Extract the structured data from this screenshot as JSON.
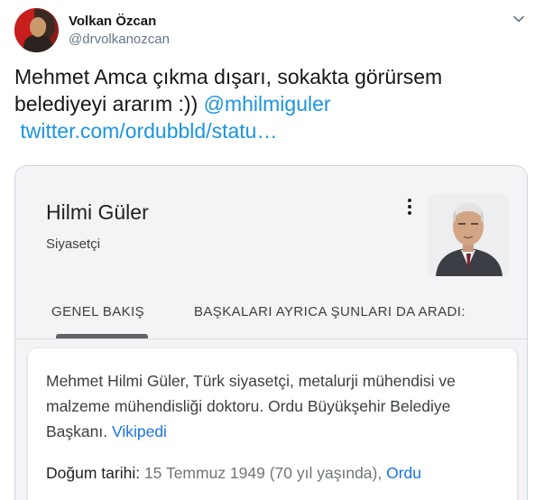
{
  "author": {
    "display_name": "Volkan Özcan",
    "handle": "@drvolkanozcan"
  },
  "tweet": {
    "text": "Mehmet Amca çıkma dışarı, sokakta görürsem belediyeyi ararım :)) ",
    "mention": "@mhilmiguler",
    "link": "twitter.com/ordubbld/statu…"
  },
  "knowledge_panel": {
    "title": "Hilmi Güler",
    "subtitle": "Siyasetçi",
    "tabs": [
      {
        "label": "GENEL BAKIŞ",
        "active": true
      },
      {
        "label": "BAŞKALARI AYRICA ŞUNLARI DA ARADI:",
        "active": false
      }
    ],
    "description": "Mehmet Hilmi Güler, Türk siyasetçi, metalurji mühendisi ve malzeme mühendisliği doktoru. Ordu Büyükşehir Belediye Başkanı. ",
    "source_link": "Vikipedi",
    "birth": {
      "label": "Doğum tarihi:",
      "value": " 15 Temmuz 1949 (70 yıl yaşında), ",
      "place": "Ordu"
    }
  },
  "icons": {
    "caret": "chevron-down-icon",
    "kebab": "more-vert-icon"
  },
  "colors": {
    "link_blue": "#1b95e0",
    "google_link": "#1a73e8",
    "secondary_text": "#657786"
  }
}
